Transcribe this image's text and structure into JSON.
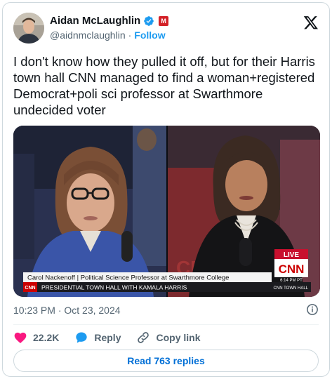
{
  "author": {
    "name": "Aidan McLaughlin",
    "handle": "@aidnmclaughlin",
    "separator": "·",
    "follow_label": "Follow",
    "affiliate_badge": "M"
  },
  "tweet": {
    "text": "I don't know how they pulled it off, but for their Harris town hall CNN managed to find a woman+registered Democrat+poli sci professor at Swarthmore undecided voter"
  },
  "media": {
    "chyron_name": "Carol Nackenoff | Political Science Professor at Swarthmore College",
    "chyron_ticker": "PRESIDENTIAL TOWN HALL WITH KAMALA HARRIS",
    "ticker_brand": "CNN",
    "ticker_right": "CNN TOWN HALL",
    "live_label": "LIVE",
    "network_logo": "CNN",
    "clock": "6:14 PM PT"
  },
  "timestamp": "10:23 PM · Oct 23, 2024",
  "actions": {
    "likes_count": "22.2K",
    "reply_label": "Reply",
    "copy_link_label": "Copy link"
  },
  "read_replies_label": "Read 763 replies",
  "colors": {
    "accent": "#1d9bf0",
    "like": "#f91880",
    "link": "#006fd6",
    "muted": "#536471"
  }
}
